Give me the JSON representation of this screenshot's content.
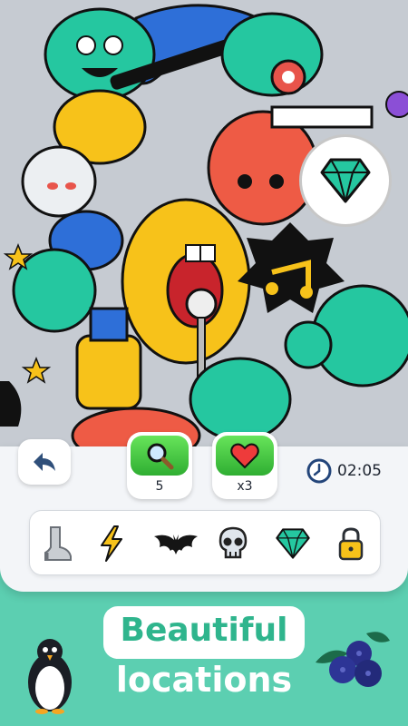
{
  "scene": {
    "highlighted_find": "diamond-icon"
  },
  "hud": {
    "back_icon": "back-arrow-icon",
    "hints": {
      "icon": "magnifier-icon",
      "count": "5"
    },
    "lives": {
      "icon": "heart-icon",
      "count": "x3"
    },
    "timer": {
      "icon": "clock-icon",
      "value": "02:05"
    }
  },
  "items": [
    {
      "icon": "boot-icon",
      "found": false
    },
    {
      "icon": "lightning-icon",
      "found": false
    },
    {
      "icon": "bat-icon",
      "found": false
    },
    {
      "icon": "skull-icon",
      "found": false
    },
    {
      "icon": "diamond-icon",
      "found": false
    },
    {
      "icon": "lock-icon",
      "found": false
    }
  ],
  "promo": {
    "line1": "Beautiful",
    "line2": "locations"
  },
  "colors": {
    "background": "#5ccfb1",
    "accent_green": "#3cc03a",
    "headline_teal": "#2fb58d"
  }
}
